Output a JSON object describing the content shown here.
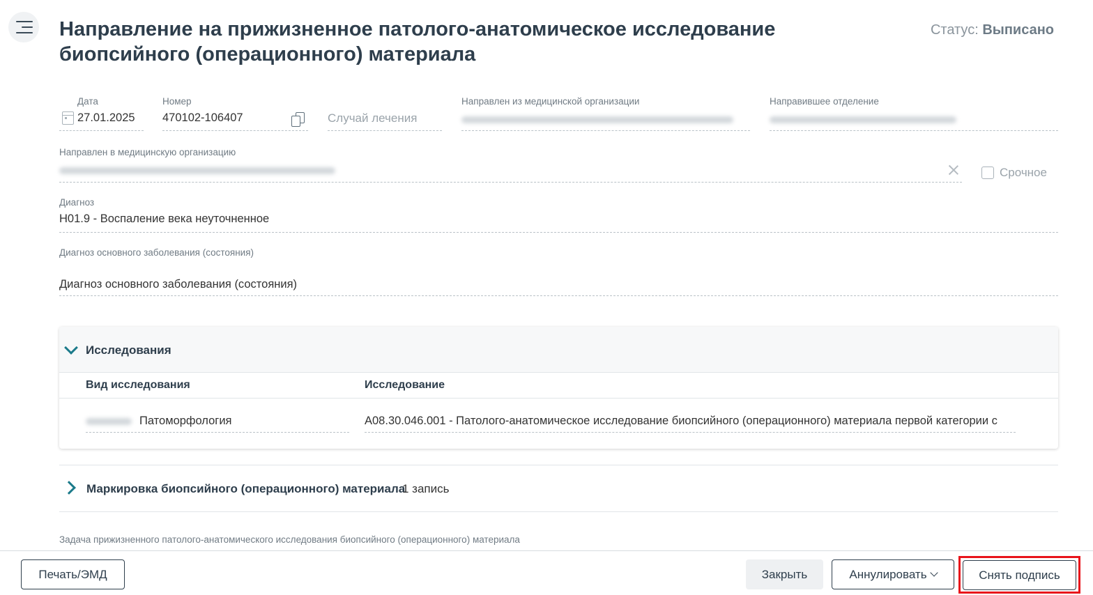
{
  "header": {
    "title": "Направление на прижизненное патолого-анатомическое исследование биопсийного (операционного) материала",
    "status_label": "Статус:",
    "status_value": "Выписано"
  },
  "form": {
    "date_label": "Дата",
    "date_value": "27.01.2025",
    "number_label": "Номер",
    "number_value": "470102-106407",
    "case_placeholder": "Случай лечения",
    "from_org_label": "Направлен из медицинской организации",
    "from_dept_label": "Направившее отделение",
    "to_org_label": "Направлен в медицинскую организацию",
    "urgent_label": "Срочное",
    "diagnosis_label": "Диагноз",
    "diagnosis_value": "H01.9 - Воспаление века неуточненное",
    "main_diagnosis_label": "Диагноз основного заболевания (состояния)",
    "main_diagnosis_placeholder": "Диагноз основного заболевания (состояния)"
  },
  "studies": {
    "title": "Исследования",
    "col_type": "Вид исследования",
    "col_study": "Исследование",
    "rows": [
      {
        "type": "Патоморфология",
        "study": "A08.30.046.001 - Патолого-анатомическое исследование биопсийного (операционного) материала первой категории с"
      }
    ]
  },
  "marking": {
    "title": "Маркировка биопсийного (операционного) материала",
    "count": "1 запись"
  },
  "task_label": "Задача прижизненного патолого-анатомического исследования биопсийного (операционного) материала",
  "footer": {
    "print_label": "Печать/ЭМД",
    "close_label": "Закрыть",
    "annul_label": "Аннулировать",
    "remove_sign_label": "Снять подпись"
  },
  "colors": {
    "accent": "#1b7a8a",
    "title": "#2e3e4c",
    "highlight": "#e8141b"
  }
}
